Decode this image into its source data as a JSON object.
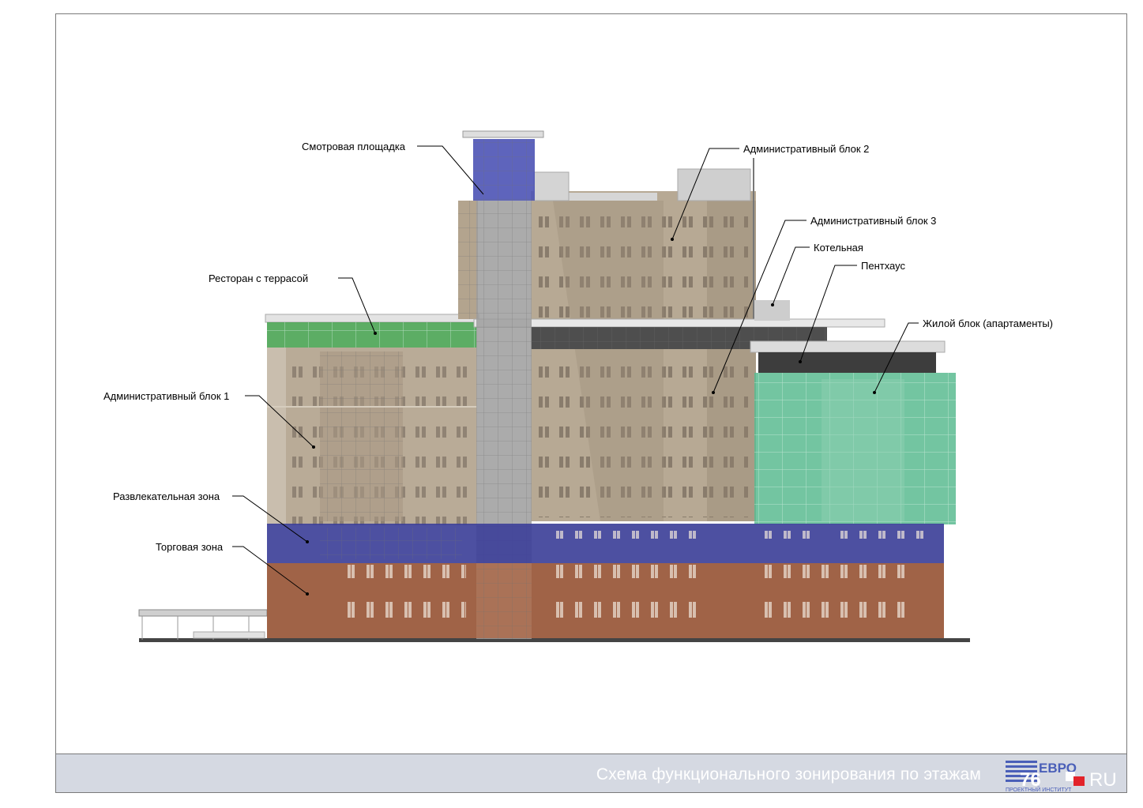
{
  "footer": {
    "title": "Схема функционального зонирования по этажам",
    "logo_top": "ЕВРО",
    "logo_number": "76",
    "logo_suffix": "RU",
    "logo_sub": "ПРОЕКТНЫЙ ИНСТИТУТ"
  },
  "labels": {
    "observation_deck": "Смотровая площадка",
    "admin_block_2": "Административный блок 2",
    "admin_block_3": "Административный блок 3",
    "boiler_room": "Котельная",
    "penthouse": "Пентхаус",
    "restaurant_terrace": "Ресторан с террасой",
    "residential_block": "Жилой блок (апартаменты)",
    "admin_block_1": "Административный блок 1",
    "entertainment_zone": "Развлекательная зона",
    "retail_zone": "Торговая зона"
  },
  "colors": {
    "retail": "#9a5a3c",
    "entertainment": "#3c3f99",
    "residential": "#4fb486",
    "restaurant": "#2f9a3a",
    "observation": "#4a4fb0",
    "facade": "#b7a994",
    "glass": "#8a8a8a",
    "footer_bg": "#d5d9e2",
    "logo_blue": "#4a5fb8",
    "logo_red": "#e2232a"
  }
}
